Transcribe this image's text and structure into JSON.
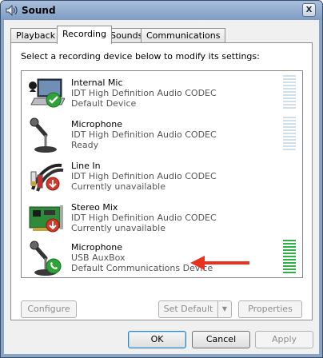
{
  "window": {
    "title": "Sound",
    "icon": "speaker-icon",
    "close_label": "X"
  },
  "tabs": [
    {
      "label": "Playback",
      "active": false
    },
    {
      "label": "Recording",
      "active": true
    },
    {
      "label": "Sounds",
      "active": false
    },
    {
      "label": "Communications",
      "active": false
    }
  ],
  "panel": {
    "instruction": "Select a recording device below to modify its settings:"
  },
  "devices": [
    {
      "name": "Internal Mic",
      "subtitle": "IDT High Definition Audio CODEC",
      "status": "Default Device",
      "icon": "laptop-mic-icon",
      "badge": "green-check-icon",
      "meter_level": 0.0
    },
    {
      "name": "Microphone",
      "subtitle": "IDT High Definition Audio CODEC",
      "status": "Ready",
      "icon": "microphone-icon",
      "badge": "",
      "meter_level": 0.0
    },
    {
      "name": "Line In",
      "subtitle": "IDT High Definition Audio CODEC",
      "status": "Currently unavailable",
      "icon": "rca-cable-icon",
      "badge": "red-down-arrow-icon",
      "meter_level": 0.0
    },
    {
      "name": "Stereo Mix",
      "subtitle": "IDT High Definition Audio CODEC",
      "status": "Currently unavailable",
      "icon": "sound-card-icon",
      "badge": "red-down-arrow-icon",
      "meter_level": 0.0
    },
    {
      "name": "Microphone",
      "subtitle": "USB AuxBox",
      "status": "Default Communications Device",
      "icon": "microphone-icon",
      "badge": "green-phone-icon",
      "meter_level": 1.0
    }
  ],
  "annotation": {
    "arrow_color": "#e8311f"
  },
  "buttons": {
    "configure": "Configure",
    "set_default": "Set Default",
    "properties": "Properties",
    "ok": "OK",
    "cancel": "Cancel",
    "apply": "Apply"
  },
  "colors": {
    "meter_idle": "#cfe0ea",
    "meter_active": "#2db142",
    "title_bar": "#8aa4c4"
  }
}
